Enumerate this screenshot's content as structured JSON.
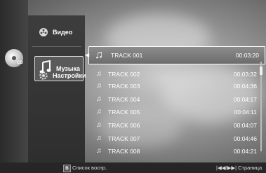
{
  "disc": {
    "label": "CD"
  },
  "menu": {
    "items": [
      {
        "label": "Видео",
        "icon": "film-reel-icon"
      },
      {
        "label": "Музыка",
        "icon": "music-note-icon"
      },
      {
        "label": "Настройки",
        "icon": "gear-icon"
      }
    ],
    "active_index": 1
  },
  "tracks": [
    {
      "title": "TRACK 001",
      "duration": "00:03:20"
    },
    {
      "title": "TRACK 002",
      "duration": "00:03:32"
    },
    {
      "title": "TRACK 003",
      "duration": "00:04:36"
    },
    {
      "title": "TRACK 004",
      "duration": "00:04:17"
    },
    {
      "title": "TRACK 005",
      "duration": "00:04:11"
    },
    {
      "title": "TRACK 006",
      "duration": "00:04:07"
    },
    {
      "title": "TRACK 007",
      "duration": "00:04:46"
    },
    {
      "title": "TRACK 008",
      "duration": "00:04:21"
    }
  ],
  "footer": {
    "button_key": "B",
    "playlist_hint": "Список воспр.",
    "page_hint": "|◀◀/▶▶| Страница"
  }
}
